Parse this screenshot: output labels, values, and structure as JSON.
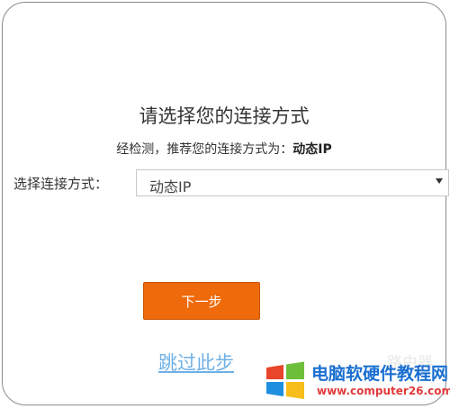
{
  "dialog": {
    "title": "请选择您的连接方式",
    "detect_prefix": "经检测，推荐您的连接方式为：",
    "detect_value": "动态IP",
    "select_label": "选择连接方式：",
    "select_value": "动态IP",
    "next_button": "下一步",
    "skip_link": "跳过此步"
  },
  "watermark": {
    "title": "电脑软硬件教程网",
    "url": "www.computer26.com",
    "faint_text": "路由器"
  },
  "colors": {
    "accent": "#ee6a0a",
    "link": "#6fb0e6",
    "watermark_blue": "#1a6fd1",
    "watermark_red": "#e23b3b"
  }
}
